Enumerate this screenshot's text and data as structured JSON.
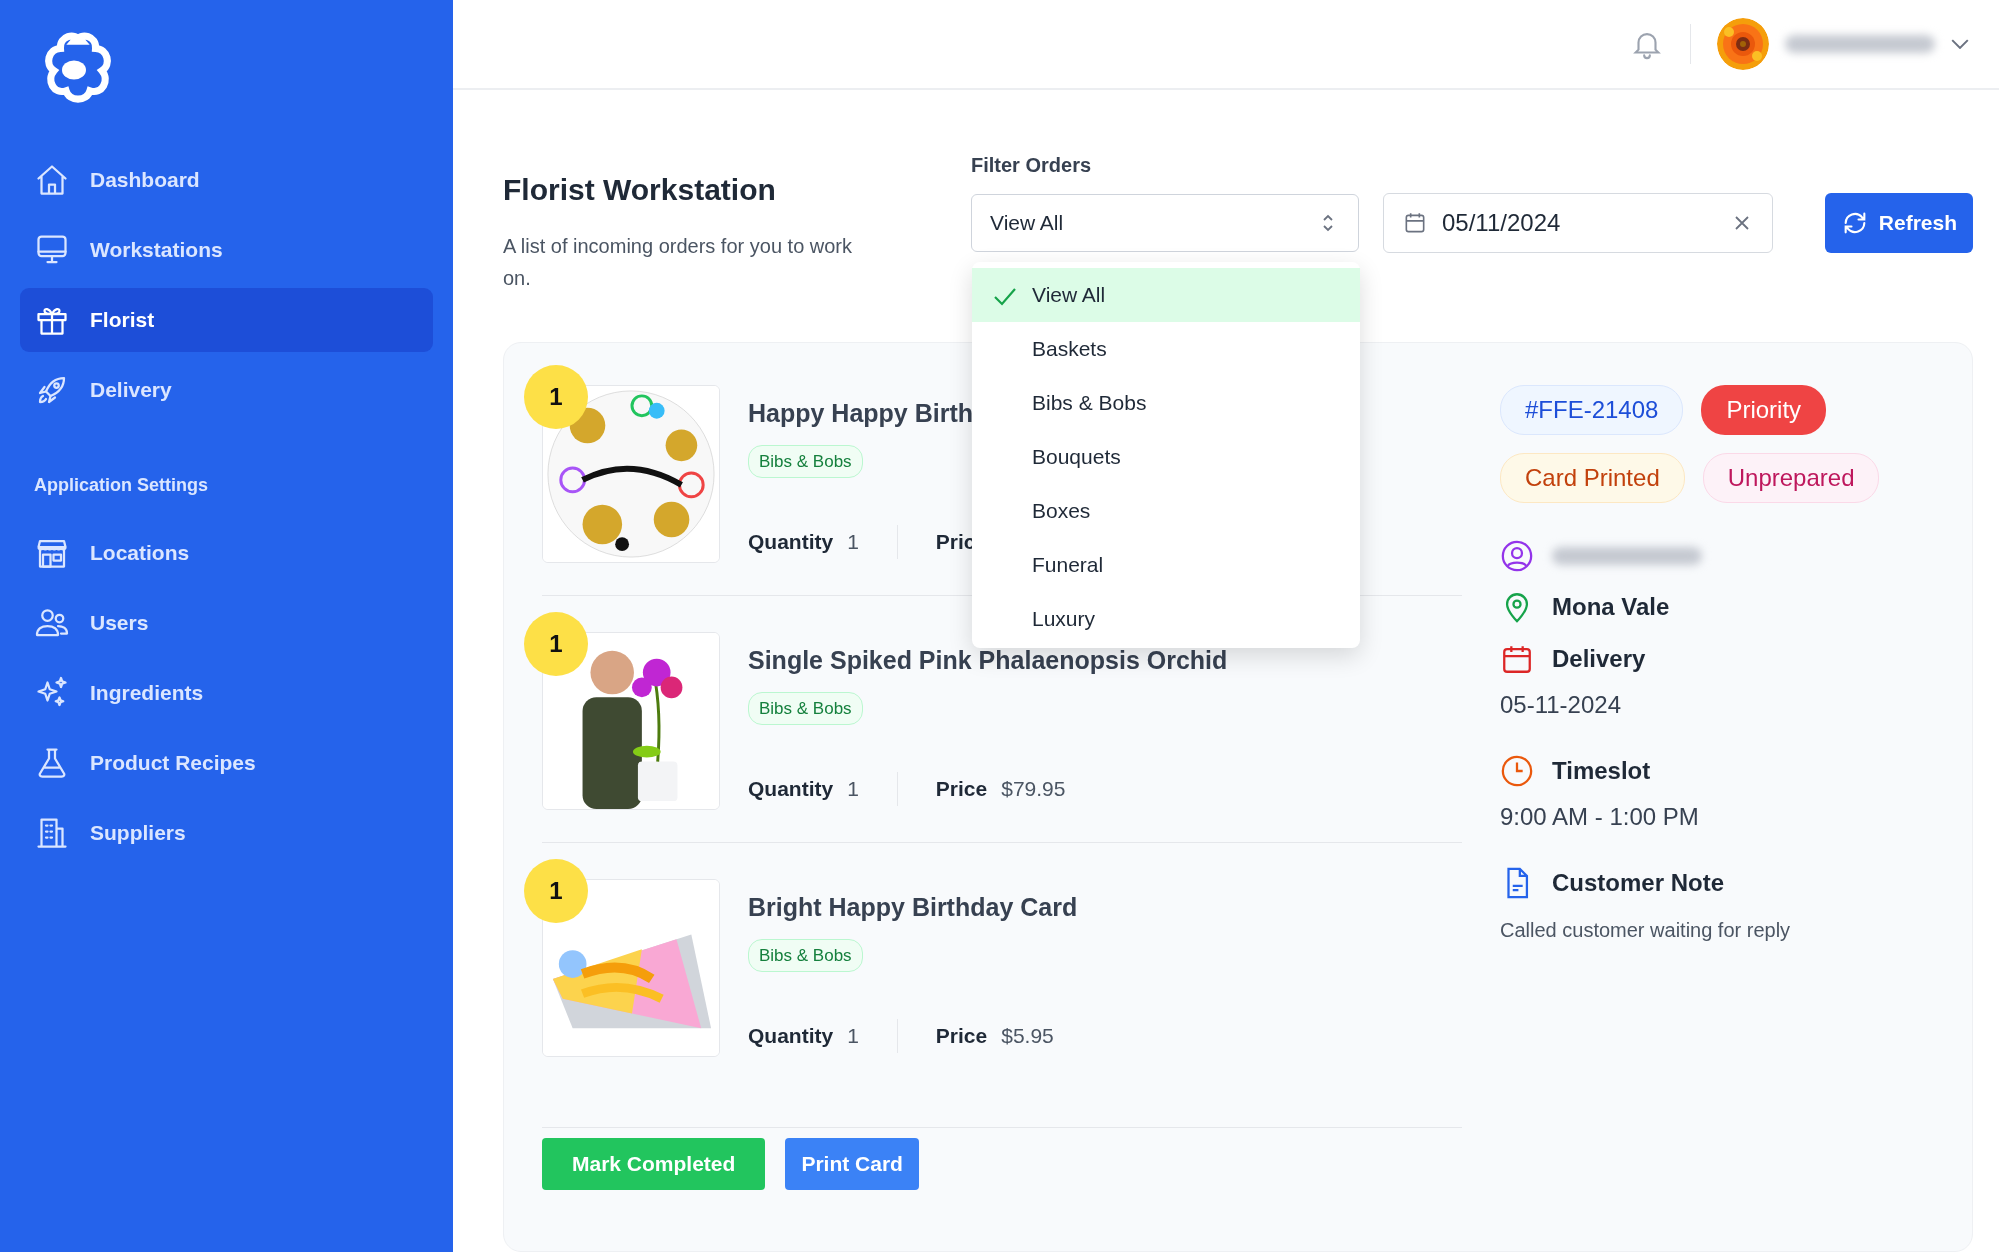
{
  "sidebar": {
    "items": [
      {
        "label": "Dashboard",
        "selected": false
      },
      {
        "label": "Workstations",
        "selected": false
      },
      {
        "label": "Florist",
        "selected": true
      },
      {
        "label": "Delivery",
        "selected": false
      }
    ],
    "section_title": "Application Settings",
    "settings_items": [
      {
        "label": "Locations",
        "selected": false
      },
      {
        "label": "Users",
        "selected": false
      },
      {
        "label": "Ingredients",
        "selected": false
      },
      {
        "label": "Product Recipes",
        "selected": false
      },
      {
        "label": "Suppliers",
        "selected": false
      }
    ]
  },
  "header": {
    "title": "Florist Workstation",
    "subtitle": "A list of incoming orders for you to work on."
  },
  "filter": {
    "label": "Filter Orders",
    "value": "View All",
    "options": [
      {
        "label": "View All",
        "selected": true
      },
      {
        "label": "Baskets",
        "selected": false
      },
      {
        "label": "Bibs & Bobs",
        "selected": false
      },
      {
        "label": "Bouquets",
        "selected": false
      },
      {
        "label": "Boxes",
        "selected": false
      },
      {
        "label": "Funeral",
        "selected": false
      },
      {
        "label": "Luxury",
        "selected": false
      }
    ]
  },
  "date_field": {
    "value": "05/11/2024"
  },
  "refresh_button": "Refresh",
  "order": {
    "items": [
      {
        "count": "1",
        "title": "Happy Happy Birth",
        "tag": "Bibs & Bobs",
        "quantity_label": "Quantity",
        "quantity": "1",
        "price_label": "Pric"
      },
      {
        "count": "1",
        "title": "Single Spiked Pink Phalaenopsis Orchid",
        "tag": "Bibs & Bobs",
        "quantity_label": "Quantity",
        "quantity": "1",
        "price_label": "Price",
        "price": "$79.95"
      },
      {
        "count": "1",
        "title": "Bright Happy Birthday Card",
        "tag": "Bibs & Bobs",
        "quantity_label": "Quantity",
        "quantity": "1",
        "price_label": "Price",
        "price": "$5.95"
      }
    ],
    "tags": [
      {
        "label": "#FFE-21408",
        "kind": "id"
      },
      {
        "label": "Priority",
        "kind": "priority"
      },
      {
        "label": "Card Printed",
        "kind": "card"
      },
      {
        "label": "Unprepared",
        "kind": "status"
      }
    ],
    "location": "Mona Vale",
    "delivery_label": "Delivery",
    "delivery_date": "05-11-2024",
    "timeslot_label": "Timeslot",
    "timeslot": "9:00 AM - 1:00 PM",
    "note_label": "Customer Note",
    "note": "Called customer waiting for reply",
    "actions": [
      {
        "label": "Mark Completed",
        "kind": "success"
      },
      {
        "label": "Print Card",
        "kind": "primary"
      }
    ]
  }
}
